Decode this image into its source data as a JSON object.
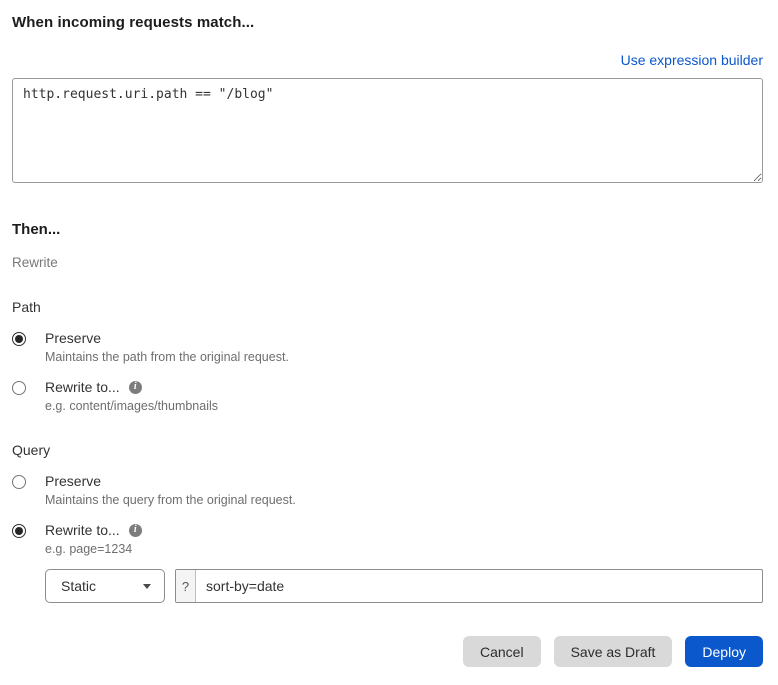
{
  "match": {
    "heading": "When incoming requests match...",
    "builder_link": "Use expression builder",
    "expression": "http.request.uri.path == \"/blog\""
  },
  "then": {
    "heading": "Then...",
    "action": "Rewrite"
  },
  "sections": [
    {
      "label": "Path",
      "options": [
        {
          "label": "Preserve",
          "description": "Maintains the path from the original request.",
          "selected": true
        },
        {
          "label": "Rewrite to...",
          "description": "e.g. content/images/thumbnails",
          "selected": false,
          "info_icon": "info-icon"
        }
      ]
    },
    {
      "label": "Query",
      "options": [
        {
          "label": "Preserve",
          "description": "Maintains the query from the original request.",
          "selected": false
        },
        {
          "label": "Rewrite to...",
          "description": "e.g. page=1234",
          "selected": true,
          "info_icon": "info-icon"
        }
      ]
    }
  ],
  "query_rewrite": {
    "type_selected": "Static",
    "prefix": "?",
    "value": "sort-by=date"
  },
  "footer": {
    "cancel": "Cancel",
    "save_draft": "Save as Draft",
    "deploy": "Deploy"
  },
  "colors": {
    "link_blue": "#0b57cb",
    "deploy_blue": "#0b57cc",
    "muted_gray": "#6e6e6e"
  }
}
